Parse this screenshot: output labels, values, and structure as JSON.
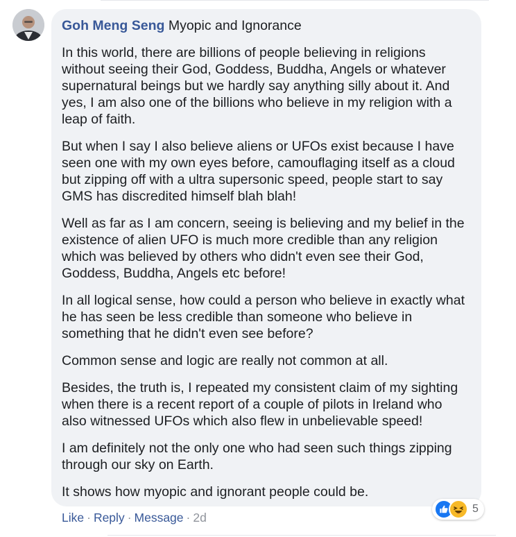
{
  "comment": {
    "author": "Goh Meng Seng",
    "title": "Myopic and Ignorance",
    "paragraphs": [
      "In this world, there are billions of people believing in religions without seeing their God, Goddess, Buddha, Angels or whatever supernatural beings but we hardly say anything silly about it. And yes, I am also one of the billions who believe in my religion with a leap of faith.",
      "But when I say I also believe aliens or UFOs exist because I have seen one with my own eyes before, camouflaging itself as a cloud but zipping off with a ultra supersonic speed, people start to say GMS has discredited himself blah blah!",
      "Well as far as I am concern, seeing is believing and my belief in the existence of alien UFO is much more credible than any religion which was believed by others who didn't even see their God, Goddess, Buddha, Angels etc before!",
      "In all logical sense, how could a person who believe in exactly what he has seen be less credible than someone who believe in something that he didn't even see before?",
      "Common sense and logic are really not common at all.",
      "Besides, the truth is, I repeated my consistent claim of my sighting when there is a recent report of a couple of pilots in Ireland who also witnessed UFOs which also flew in unbelievable speed!",
      "I am definitely not the only one who had seen such things zipping through our sky on Earth.",
      "It shows how myopic and ignorant people could be."
    ]
  },
  "actions": {
    "like": "Like",
    "reply": "Reply",
    "message": "Message",
    "separator": "·",
    "time": "2d"
  },
  "reactions": {
    "icons": [
      "like-icon",
      "haha-icon"
    ],
    "count": "5"
  },
  "colors": {
    "author": "#385898",
    "bubble": "#f0f2f5",
    "like": "#1877f2",
    "haha": "#f7b928"
  }
}
